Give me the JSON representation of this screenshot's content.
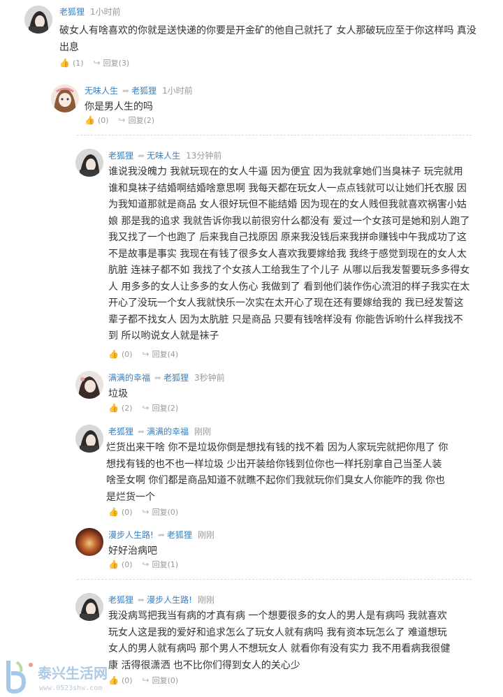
{
  "comments": [
    {
      "user": "老狐狸",
      "reply_to": "",
      "time": "1小时前",
      "text": "破女人有啥喜欢的你就是送快递的你要是开金矿的他自己就托了 女人那破玩应至于你这样吗 真没出息",
      "likes": "(1)",
      "reply_label": "回复",
      "reply_count": "(3)",
      "avatar_color": "#5a5a5a"
    },
    {
      "user": "无味人生",
      "reply_to": "老狐狸",
      "time": "1小时前",
      "text": "你是男人生的吗",
      "likes": "(0)",
      "reply_label": "回复",
      "reply_count": "(2)",
      "avatar_color": "#c98a78"
    },
    {
      "user": "老狐狸",
      "reply_to": "无味人生",
      "time": "13分钟前",
      "text": "谁说我没魄力 我就玩现在的女人牛逼 因为便宜 因为我就拿她们当臭袜子 玩完就用谁和臭袜子结婚啊结婚啥意思啊 我每天都在玩女人一点点钱就可以让她们托衣服 因为我知道那就是商品 女人很好玩但不能结婚 因为现在的女人贱但我就喜欢祸害小姑娘 那是我的追求 我就告诉你我以前很穷什么都没有 爱过一个女孩可是她和别人跑了 我又找了一个也跑了 后来我自己找原因 原来我没钱后来我拼命赚钱中午我成功了这不是故事是事实 我现在有钱了很多女人喜欢我要嫁给我 我终于感觉到现在的女人太肮脏 连袜子都不如 我找了个女孩人工给我生了个儿子 从哪以后我发誓要玩多多得女人 用多多的女人让多多的女人伤心 我做到了 看到他们装作伤心流泪的样子我实在太开心了没玩一个女人我就快乐一次实在太开心了现在还有要嫁给我的 我已经发誓这辈子都不找女人 因为太肮脏 只是商品 只要有钱啥样没有 你能告诉哟什么样我找不到 所以哟说女人就是袜子",
      "likes": "(0)",
      "reply_label": "回复",
      "reply_count": "(4)",
      "avatar_color": "#5a5a5a"
    },
    {
      "user": "满满的幸福",
      "reply_to": "老狐狸",
      "time": "3秒钟前",
      "text": "垃圾",
      "likes": "(2)",
      "reply_label": "回复",
      "reply_count": "(2)",
      "avatar_color": "#7a6a6a"
    },
    {
      "user": "老狐狸",
      "reply_to": "满满的幸福",
      "time": "刚刚",
      "text": "烂货出来干啥 你不是垃圾你倒是想找有钱的找不着 因为人家玩完就把你甩了 你想找有钱的也不也一样垃圾 少出开装给你钱到位你也一样托别拿自己当圣人装啥圣女啊 你们都是商品知道不就瞧不起你们我就玩你们臭女人你能咋的我 你也是烂货一个",
      "likes": "(0)",
      "reply_label": "回复",
      "reply_count": "(0)",
      "avatar_color": "#5a5a5a"
    },
    {
      "user": "漫步人生路!",
      "reply_to": "老狐狸",
      "time": "刚刚",
      "text": "好好治病吧",
      "likes": "(0)",
      "reply_label": "回复",
      "reply_count": "(1)",
      "avatar_color": "#8a3a28"
    },
    {
      "user": "老狐狸",
      "reply_to": "漫步人生路!",
      "time": "刚刚",
      "text": "我没病骂把我当有病的才真有病 一个想要很多的女人的男人是有病吗 我就喜欢玩女人这是我的爱好和追求怎么了玩女人就有病吗 我有资本玩怎么了 难道想玩女人的男人就有病吗 那个男人不想玩女人 就看你有没有实力 我不用看病我很健康 活得很潇洒 也不比你们得到女人的关心少",
      "likes": "(0)",
      "reply_label": "回复",
      "reply_count": "(0)",
      "avatar_color": "#5a5a5a"
    }
  ],
  "watermark": {
    "site_name": "泰兴生活网",
    "url": "www.0523shw.com"
  },
  "colors": {
    "username": "#3a7fc1",
    "time": "#999999",
    "text": "#333333",
    "action": "#999999"
  }
}
